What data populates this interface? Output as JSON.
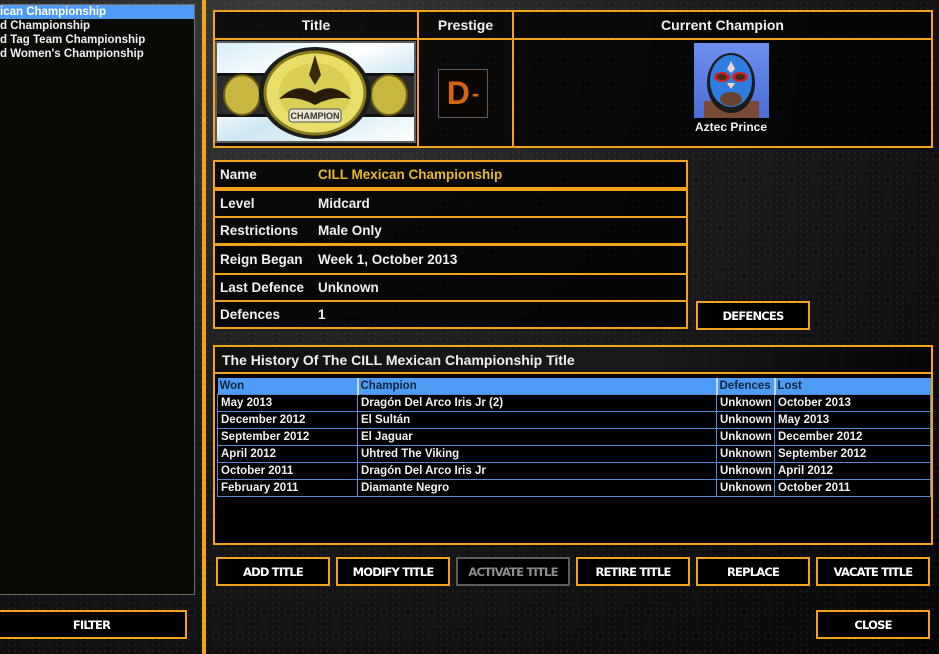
{
  "title_list": {
    "items": [
      {
        "label": "CILL Mexican Championship",
        "selected": true
      },
      {
        "label": "CILL World Championship",
        "selected": false
      },
      {
        "label": "CILL World Tag Team Championship",
        "selected": false
      },
      {
        "label": "CILL World Women's Championship",
        "selected": false
      }
    ],
    "visible_labels": [
      "ican Championship",
      "d Championship",
      "d Tag Team Championship",
      "d Women's Championship"
    ]
  },
  "filter_button": "FILTER",
  "summary": {
    "headers": {
      "title": "Title",
      "prestige": "Prestige",
      "current_champion": "Current Champion"
    },
    "prestige_grade": "D",
    "prestige_modifier": "-",
    "champion_name": "Aztec Prince",
    "belt_plate_text": "CHAMPION"
  },
  "details": [
    {
      "label": "Name",
      "value": "CILL Mexican Championship",
      "highlight": true
    },
    {
      "label": "Level",
      "value": "Midcard"
    },
    {
      "label": "Restrictions",
      "value": "Male Only"
    },
    {
      "label": "Reign Began",
      "value": "Week 1, October 2013"
    },
    {
      "label": "Last Defence",
      "value": "Unknown"
    },
    {
      "label": "Defences",
      "value": "1"
    }
  ],
  "defences_button": "DEFENCES",
  "history": {
    "title": "The History Of The CILL Mexican Championship Title",
    "columns": [
      "Won",
      "Champion",
      "Defences",
      "Lost"
    ],
    "rows": [
      {
        "won": "May 2013",
        "champion": "Dragón Del Arco Iris Jr (2)",
        "defences": "Unknown",
        "lost": "October 2013"
      },
      {
        "won": "December 2012",
        "champion": "El Sultán",
        "defences": "Unknown",
        "lost": "May 2013"
      },
      {
        "won": "September 2012",
        "champion": "El Jaguar",
        "defences": "Unknown",
        "lost": "December 2012"
      },
      {
        "won": "April 2012",
        "champion": "Uhtred The Viking",
        "defences": "Unknown",
        "lost": "September 2012"
      },
      {
        "won": "October 2011",
        "champion": "Dragón Del Arco Iris Jr",
        "defences": "Unknown",
        "lost": "April 2012"
      },
      {
        "won": "February 2011",
        "champion": "Diamante Negro",
        "defences": "Unknown",
        "lost": "October 2011"
      }
    ]
  },
  "actions": {
    "add_title": "ADD TITLE",
    "modify_title": "MODIFY TITLE",
    "activate_title": "ACTIVATE TITLE",
    "retire_title": "RETIRE TITLE",
    "replace": "REPLACE",
    "vacate_title": "VACATE TITLE",
    "close": "CLOSE"
  },
  "colors": {
    "accent": "#f2a21b",
    "selection": "#4d9bf5",
    "title_name": "#e7b82c",
    "prestige": "#d5660f"
  }
}
